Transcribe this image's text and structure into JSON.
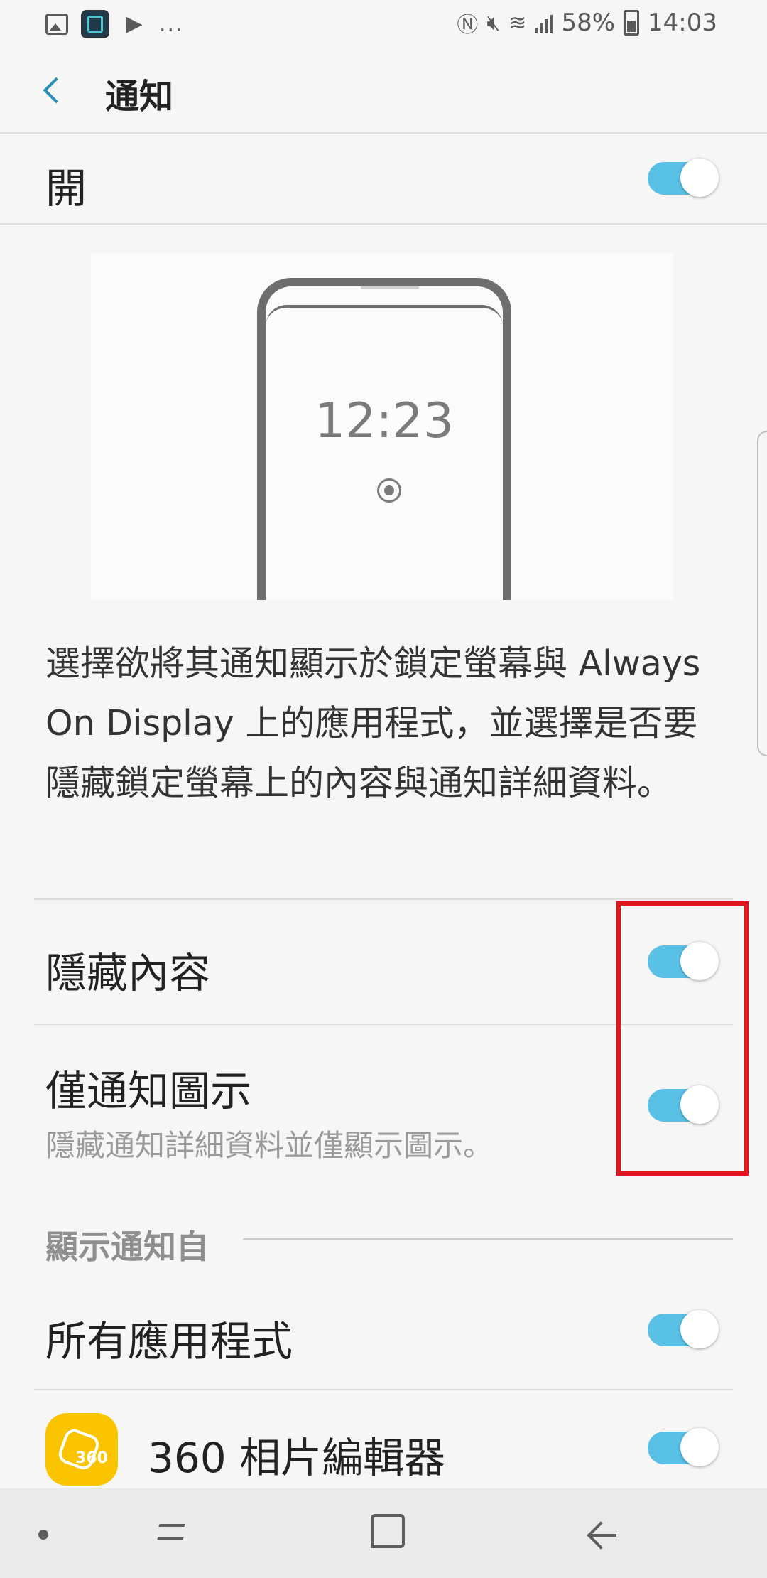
{
  "status_bar": {
    "more": "...",
    "battery": "58%",
    "time": "14:03",
    "icons": [
      "gallery-icon",
      "app-notification-icon",
      "play-store-icon",
      "nfc-icon",
      "mute-icon",
      "wifi-icon",
      "signal-icon",
      "battery-icon"
    ]
  },
  "app_bar": {
    "title": "通知"
  },
  "master": {
    "label": "開",
    "on": true
  },
  "illustration": {
    "clock": "12:23"
  },
  "description": "選擇欲將其通知顯示於鎖定螢幕與 Always On Display 上的應用程式，並選擇是否要隱藏鎖定螢幕上的內容與通知詳細資料。",
  "settings": {
    "hide_content": {
      "label": "隱藏內容",
      "on": true
    },
    "icons_only": {
      "label": "僅通知圖示",
      "sub": "隱藏通知詳細資料並僅顯示圖示。",
      "on": true
    }
  },
  "section": {
    "header": "顯示通知自"
  },
  "apps": {
    "all": {
      "label": "所有應用程式",
      "on": true
    },
    "first": {
      "label": "360 相片編輯器",
      "icon_text": "360",
      "on": true
    }
  },
  "colors": {
    "accent": "#59c0e6",
    "highlight": "#e0161f",
    "back_arrow": "#2a8fb5"
  }
}
